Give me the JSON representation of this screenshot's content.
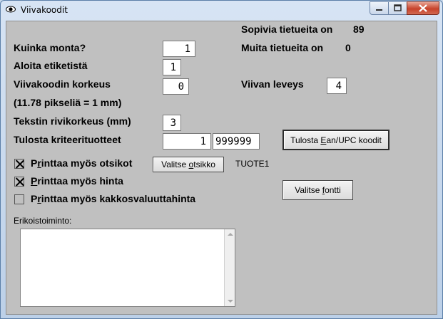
{
  "window": {
    "title": "Viivakoodit"
  },
  "stats": {
    "matching_label": "Sopivia tietueita on",
    "matching_value": "89",
    "other_label": "Muita tietueita on",
    "other_value": "0"
  },
  "form": {
    "count_label": "Kuinka monta?",
    "count_value": "1",
    "start_label": "Aloita etiketistä",
    "start_value": "1",
    "height_label": "Viivakoodin korkeus",
    "height_value": "0",
    "height_note": "(11.78 pikseliä = 1 mm)",
    "width_label": "Viivan leveys",
    "width_value": "4",
    "line_height_label": "Tekstin rivikorkeus (mm)",
    "line_height_value": "3",
    "criteria_label": "Tulosta kriteerituotteet",
    "criteria_from": "1",
    "criteria_to": "999999"
  },
  "checkboxes": {
    "print_header": {
      "label_pre": "P",
      "label_u": "r",
      "label_post": "inttaa myös otsikot",
      "checked": true
    },
    "print_price": {
      "label_pre": "",
      "label_u": "P",
      "label_post": "rinttaa myös hinta",
      "checked": true
    },
    "print_second_currency": {
      "label_pre": "P",
      "label_u": "r",
      "label_post": "inttaa myös kakkosvaluuttahinta",
      "checked": false
    }
  },
  "buttons": {
    "print_ean_pre": "Tulosta ",
    "print_ean_u": "E",
    "print_ean_post": "an/UPC koodit",
    "select_header_pre": "Valitse ",
    "select_header_u": "o",
    "select_header_post": "tsikko",
    "select_font_pre": "Valitse ",
    "select_font_u": "f",
    "select_font_post": "ontti"
  },
  "header_value": "TUOTE1",
  "special_label": "Erikoistoiminto:",
  "special_value": ""
}
